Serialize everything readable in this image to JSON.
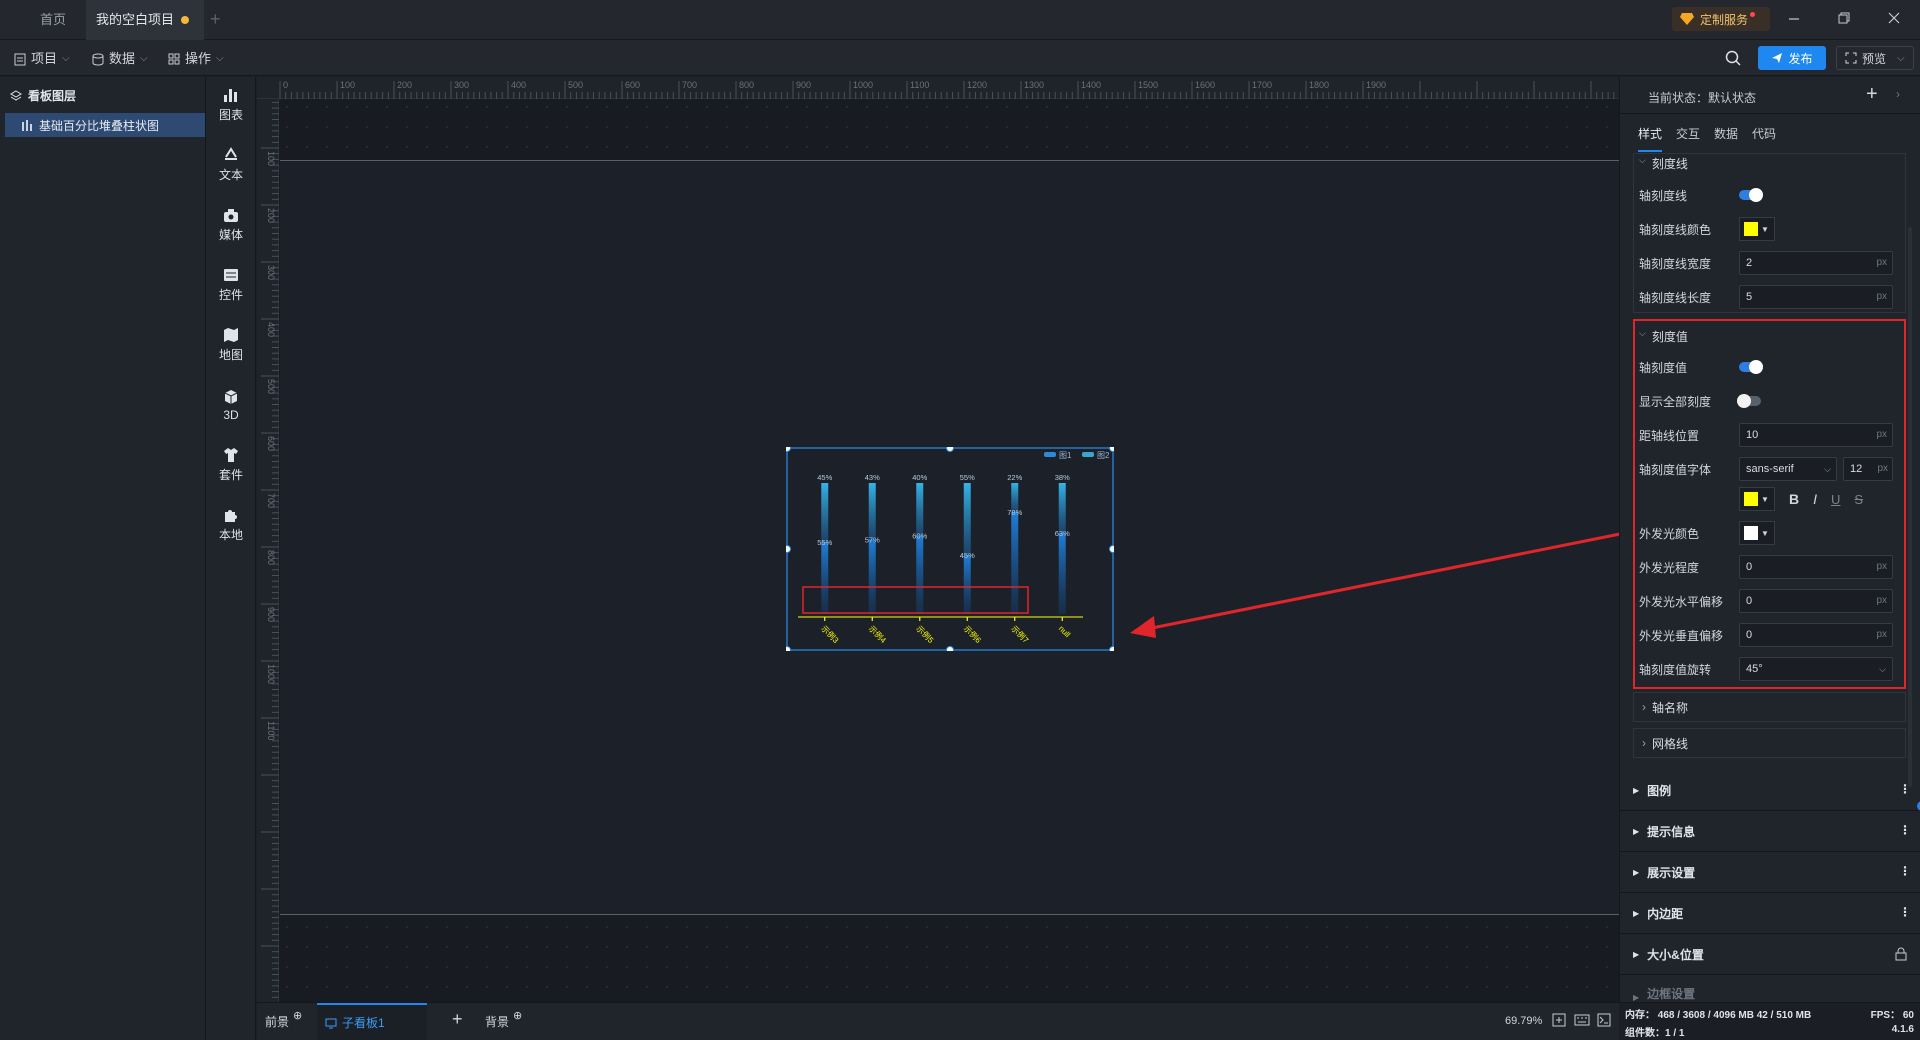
{
  "titlebar": {
    "tabs": [
      "首页",
      "我的空白项目"
    ],
    "custom_service": "定制服务",
    "colors": {
      "modified_dot": "#f5b93a",
      "accent": "#1e88f0"
    }
  },
  "menubar": {
    "items": [
      "项目",
      "数据",
      "操作"
    ],
    "publish": "发布",
    "preview": "预览"
  },
  "layers": {
    "title": "看板图层",
    "items": [
      "基础百分比堆叠柱状图"
    ]
  },
  "left_tools": [
    "图表",
    "文本",
    "媒体",
    "控件",
    "地图",
    "3D",
    "套件",
    "本地"
  ],
  "ruler": {
    "h_ticks": [
      "0",
      "100",
      "200",
      "300",
      "400",
      "500",
      "600",
      "700",
      "800",
      "900",
      "1000",
      "1100",
      "1200",
      "1300",
      "1400",
      "1500",
      "1600",
      "1700",
      "1800",
      "1900"
    ],
    "v_ticks": [
      "0",
      "100",
      "200",
      "300",
      "400",
      "500",
      "600",
      "700",
      "800",
      "900",
      "1000",
      "1100"
    ]
  },
  "chart_data": {
    "type": "bar",
    "stacked": "percent",
    "categories": [
      "示例3",
      "示例4",
      "示例5",
      "示例6",
      "示例7",
      "null"
    ],
    "series": [
      {
        "name": "图1",
        "values": [
          45,
          43,
          40,
          55,
          22,
          38
        ],
        "labels": [
          "45%",
          "43%",
          "40%",
          "55%",
          "22%",
          "38%"
        ]
      },
      {
        "name": "图2",
        "values": [
          55,
          57,
          60,
          45,
          78,
          62
        ],
        "labels": [
          "55%",
          "57%",
          "60%",
          "45%",
          "78%",
          "63%"
        ]
      }
    ],
    "ylim": [
      0,
      100
    ],
    "legend": "top-right",
    "axis_tick_color": "#ffff00",
    "tick_rotation_deg": 45
  },
  "bottombar": {
    "front": "前景",
    "subboard": "子看板1",
    "background": "背景",
    "zoom": "69.79%"
  },
  "status": {
    "memory": "内存： 468 / 3608 / 4096 MB  42 / 510 MB",
    "fps": "FPS： 60",
    "components": "组件数：1 / 1",
    "version": "4.1.6"
  },
  "right": {
    "state_label": "当前状态：",
    "state_value": "默认状态",
    "tabs": [
      "样式",
      "交互",
      "数据",
      "代码"
    ],
    "tickline": {
      "title": "刻度线",
      "show_label": "轴刻度线",
      "color_label": "轴刻度线颜色",
      "color": "#ffff00",
      "width_label": "轴刻度线宽度",
      "width": "2",
      "length_label": "轴刻度线长度",
      "length": "5",
      "unit": "px"
    },
    "tickvalue": {
      "title": "刻度值",
      "show_label": "轴刻度值",
      "show_all_label": "显示全部刻度",
      "offset_label": "距轴线位置",
      "offset": "10",
      "font_label": "轴刻度值字体",
      "font": "sans-serif",
      "font_size": "12",
      "font_color": "#ffff00",
      "glow_color_label": "外发光颜色",
      "glow_color": "#ffffff",
      "glow_level_label": "外发光程度",
      "glow_level": "0",
      "glow_x_label": "外发光水平偏移",
      "glow_x": "0",
      "glow_y_label": "外发光垂直偏移",
      "glow_y": "0",
      "rotate_label": "轴刻度值旋转",
      "rotate": "45°",
      "unit": "px",
      "fmt": {
        "bold": "B",
        "italic": "I",
        "underline": "U",
        "strike": "S"
      }
    },
    "collapsed_sections": [
      "轴名称",
      "网格线"
    ],
    "groups": [
      "图例",
      "提示信息",
      "展示设置",
      "内边距",
      "大小&位置",
      "边框设置"
    ]
  }
}
